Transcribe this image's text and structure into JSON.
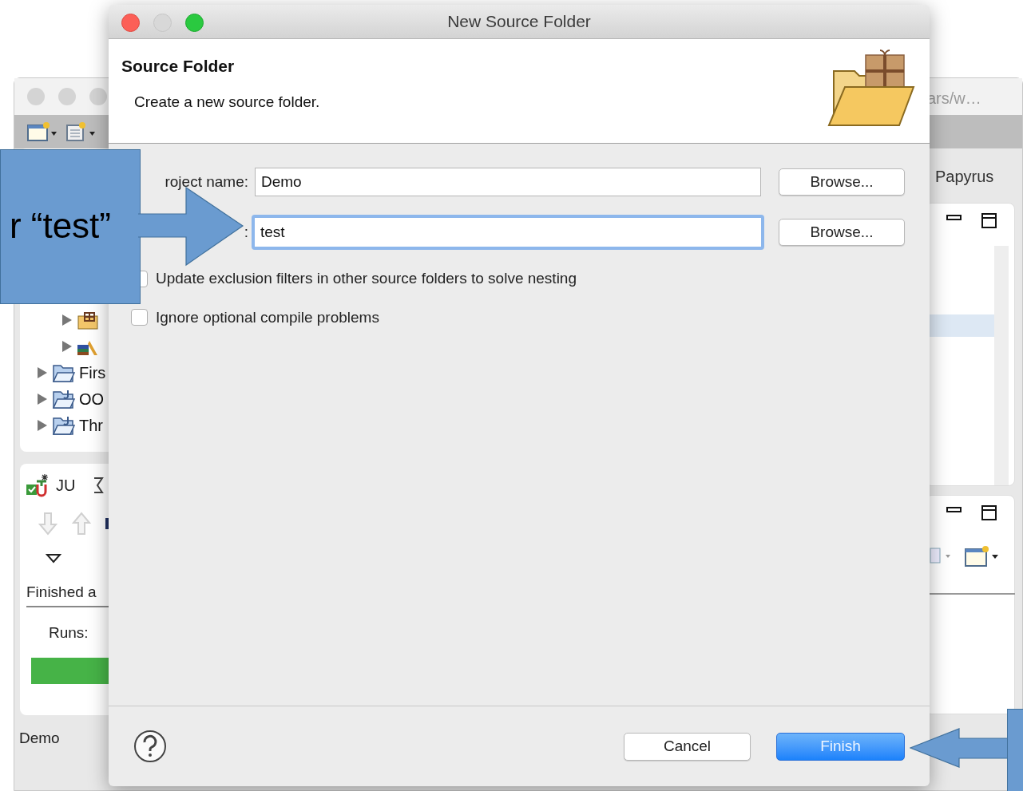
{
  "background_window": {
    "title": "ars/w…",
    "perspective": "Papyrus",
    "tree": [
      {
        "kind": "group",
        "children": [
          {
            "kind": "package",
            "expanded": false
          },
          {
            "kind": "library",
            "expanded": false
          }
        ]
      },
      {
        "kind": "folder",
        "label": "Firs",
        "expanded": false
      },
      {
        "kind": "project",
        "label": "OO",
        "expanded": false
      },
      {
        "kind": "project",
        "label": "Thr",
        "expanded": false
      }
    ],
    "junit": {
      "tab_label": "JU",
      "status": "Finished a",
      "runs_label": "Runs:"
    },
    "status_bar": "Demo"
  },
  "dialog": {
    "title": "New Source Folder",
    "heading": "Source Folder",
    "description": "Create a new source folder.",
    "fields": [
      {
        "label": "roject name:",
        "value": "Demo",
        "focused": false,
        "button": "Browse..."
      },
      {
        "label": ":",
        "value": "test",
        "focused": true,
        "button": "Browse..."
      }
    ],
    "checkboxes": [
      {
        "label": "Update exclusion filters in other source folders to solve nesting",
        "checked": false
      },
      {
        "label": "Ignore optional compile problems",
        "checked": false
      }
    ],
    "buttons": [
      {
        "label": "Cancel",
        "kind": "default"
      },
      {
        "label": "Finish",
        "kind": "primary"
      }
    ]
  },
  "callouts": [
    {
      "kind": "left",
      "text": "r “test”"
    },
    {
      "kind": "right"
    }
  ]
}
